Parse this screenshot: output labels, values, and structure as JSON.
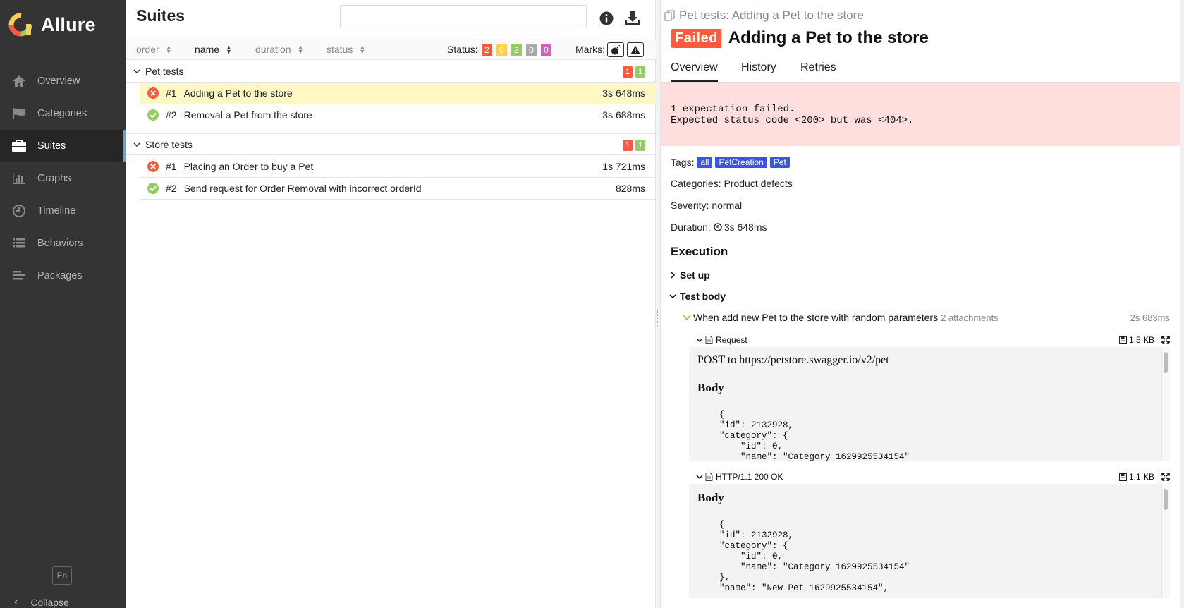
{
  "app": {
    "name": "Allure"
  },
  "sidebar": {
    "items": [
      {
        "label": "Overview",
        "icon": "home-icon"
      },
      {
        "label": "Categories",
        "icon": "flag-icon"
      },
      {
        "label": "Suites",
        "icon": "briefcase-icon",
        "active": true
      },
      {
        "label": "Graphs",
        "icon": "bar-chart-icon"
      },
      {
        "label": "Timeline",
        "icon": "clock-icon"
      },
      {
        "label": "Behaviors",
        "icon": "list-icon"
      },
      {
        "label": "Packages",
        "icon": "align-left-icon"
      }
    ],
    "language": "En",
    "collapse_label": "Collapse"
  },
  "suites": {
    "title": "Suites",
    "search_placeholder": "",
    "sort": {
      "order": "order",
      "name": "name",
      "duration": "duration",
      "status": "status"
    },
    "status_label": "Status:",
    "status_counts": {
      "failed": "2",
      "broken": "0",
      "passed": "2",
      "skipped": "0",
      "unknown": "0"
    },
    "marks_label": "Marks:",
    "groups": [
      {
        "name": "Pet tests",
        "failed": "1",
        "passed": "1",
        "tests": [
          {
            "num": "#1",
            "name": "Adding a Pet to the store",
            "duration": "3s 648ms",
            "status": "failed",
            "selected": true
          },
          {
            "num": "#2",
            "name": "Removal a Pet from the store",
            "duration": "3s 688ms",
            "status": "passed"
          }
        ]
      },
      {
        "name": "Store tests",
        "failed": "1",
        "passed": "1",
        "tests": [
          {
            "num": "#1",
            "name": "Placing an Order to buy a Pet",
            "duration": "1s 721ms",
            "status": "failed"
          },
          {
            "num": "#2",
            "name": "Send request for Order Removal with incorrect orderId",
            "duration": "828ms",
            "status": "passed"
          }
        ]
      }
    ]
  },
  "details": {
    "breadcrumb": "Pet tests: Adding a Pet to the store",
    "status_badge": "Failed",
    "title": "Adding a Pet to the store",
    "tabs": [
      "Overview",
      "History",
      "Retries"
    ],
    "error_message": "1 expectation failed.\nExpected status code <200> but was <404>.",
    "tags_label": "Tags:",
    "tags": [
      "all",
      "PetCreation",
      "Pet"
    ],
    "categories": "Categories: Product defects",
    "severity": "Severity: normal",
    "duration_label": "Duration:",
    "duration": "3s 648ms",
    "execution_title": "Execution",
    "setup_label": "Set up",
    "test_body_label": "Test body",
    "step": {
      "name": "When add new Pet to the store with random parameters",
      "attachments": "2 attachments",
      "duration": "2s 683ms"
    },
    "attachments": [
      {
        "name": "Request",
        "size": "1.5 KB",
        "first_line": "POST to https://petstore.swagger.io/v2/pet",
        "body_label": "Body",
        "code": "{\n\"id\": 2132928,\n\"category\": {\n    \"id\": 0,\n    \"name\": \"Category 1629925534154\""
      },
      {
        "name": "HTTP/1.1 200 OK",
        "size": "1.1 KB",
        "body_label": "Body",
        "code": "{\n\"id\": 2132928,\n\"category\": {\n    \"id\": 0,\n    \"name\": \"Category 1629925534154\"\n},\n\"name\": \"New Pet 1629925534154\","
      }
    ]
  },
  "colors": {
    "sidebar_bg": "#343434",
    "active_accent": "#58a6e0",
    "failed": "#fd5a3e",
    "broken": "#ffd050",
    "passed": "#97cc64",
    "skipped": "#aaaaaa",
    "unknown": "#d35ebe",
    "tag": "#3b55e0",
    "selected_row": "#fff8c5",
    "error_bg": "#ffdede"
  }
}
